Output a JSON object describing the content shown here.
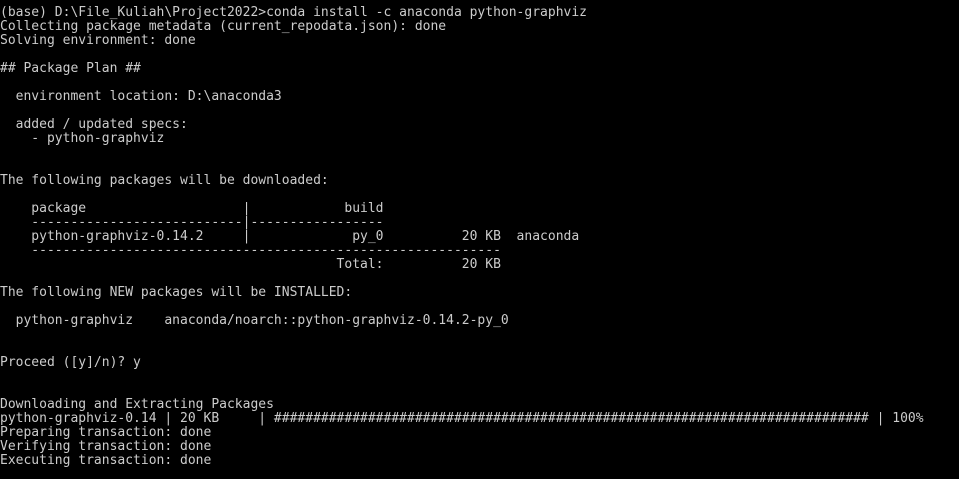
{
  "terminal": {
    "lines": [
      "(base) D:\\File_Kuliah\\Project2022>conda install -c anaconda python-graphviz",
      "Collecting package metadata (current_repodata.json): done",
      "Solving environment: done",
      "",
      "## Package Plan ##",
      "",
      "  environment location: D:\\anaconda3",
      "",
      "  added / updated specs:",
      "    - python-graphviz",
      "",
      "",
      "The following packages will be downloaded:",
      "",
      "    package                    |            build",
      "    ---------------------------|-----------------",
      "    python-graphviz-0.14.2     |             py_0          20 KB  anaconda",
      "    ------------------------------------------------------------",
      "                                           Total:          20 KB",
      "",
      "The following NEW packages will be INSTALLED:",
      "",
      "  python-graphviz    anaconda/noarch::python-graphviz-0.14.2-py_0",
      "",
      "",
      "Proceed ([y]/n)? y",
      "",
      "",
      "Downloading and Extracting Packages",
      "python-graphviz-0.14 | 20 KB     | ############################################################################ | 100%",
      "Preparing transaction: done",
      "Verifying transaction: done",
      "Executing transaction: done"
    ]
  },
  "colors": {
    "background": "#000000",
    "foreground": "#cccccc"
  }
}
